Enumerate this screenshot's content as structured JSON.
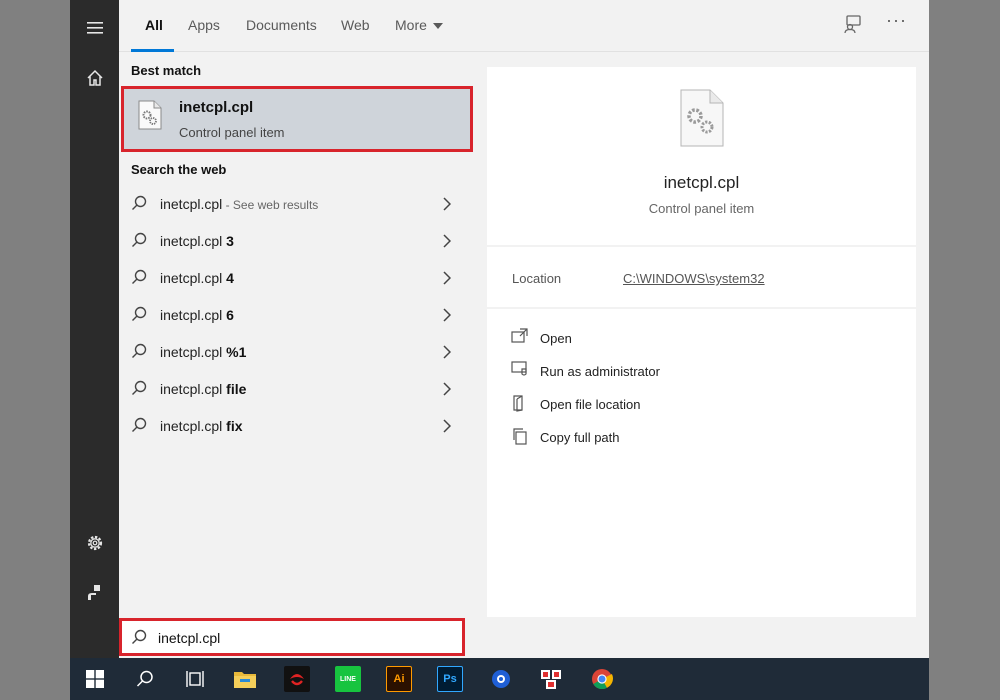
{
  "tabs": [
    {
      "label": "All",
      "active": true
    },
    {
      "label": "Apps"
    },
    {
      "label": "Documents"
    },
    {
      "label": "Web"
    },
    {
      "label": "More"
    }
  ],
  "icons": {
    "menu": "hamburger-menu-icon",
    "home": "home-icon",
    "settings": "gear-icon",
    "user": "user-icon",
    "feedback": "feedback-icon",
    "more": "ellipsis-icon"
  },
  "best_match": {
    "section_label": "Best match",
    "title": "inetcpl.cpl",
    "subtitle": "Control panel item"
  },
  "web": {
    "section_label": "Search the web",
    "items": [
      {
        "prefix": "inetcpl.cpl",
        "bold": "",
        "hint": " - See web results"
      },
      {
        "prefix": "inetcpl.cpl ",
        "bold": "3",
        "hint": ""
      },
      {
        "prefix": "inetcpl.cpl ",
        "bold": "4",
        "hint": ""
      },
      {
        "prefix": "inetcpl.cpl ",
        "bold": "6",
        "hint": ""
      },
      {
        "prefix": "inetcpl.cpl ",
        "bold": "%1",
        "hint": ""
      },
      {
        "prefix": "inetcpl.cpl ",
        "bold": "file",
        "hint": ""
      },
      {
        "prefix": "inetcpl.cpl ",
        "bold": "fix",
        "hint": ""
      }
    ]
  },
  "search": {
    "value": "inetcpl.cpl"
  },
  "preview": {
    "title": "inetcpl.cpl",
    "subtitle": "Control panel item",
    "location_label": "Location",
    "location_value": "C:\\WINDOWS\\system32",
    "actions": [
      {
        "label": "Open",
        "icon": "open-icon"
      },
      {
        "label": "Run as administrator",
        "icon": "run-as-admin-icon"
      },
      {
        "label": "Open file location",
        "icon": "file-location-icon"
      },
      {
        "label": "Copy full path",
        "icon": "copy-icon"
      }
    ]
  },
  "taskbar": {
    "items": [
      {
        "name": "start-button",
        "icon": "windows-logo-icon"
      },
      {
        "name": "taskbar-search",
        "icon": "search-icon"
      },
      {
        "name": "task-view",
        "icon": "task-view-icon"
      },
      {
        "name": "file-explorer",
        "icon": "folder-icon"
      },
      {
        "name": "app-garena",
        "icon": "garena-icon"
      },
      {
        "name": "app-line",
        "icon": "line-icon",
        "text": "LINE"
      },
      {
        "name": "app-illustrator",
        "icon": "illustrator-icon",
        "text": "Ai"
      },
      {
        "name": "app-photoshop",
        "icon": "photoshop-icon",
        "text": "Ps"
      },
      {
        "name": "app-blue",
        "icon": "blue-app-icon"
      },
      {
        "name": "app-redwhite",
        "icon": "redwhite-app-icon"
      },
      {
        "name": "app-chrome",
        "icon": "chrome-icon"
      }
    ]
  },
  "colors": {
    "accent": "#0078d7",
    "highlight_border": "#d8242c",
    "rail": "#2b2b2b",
    "taskbar": "#1f2b38",
    "selected_bg": "#cfd4da"
  }
}
